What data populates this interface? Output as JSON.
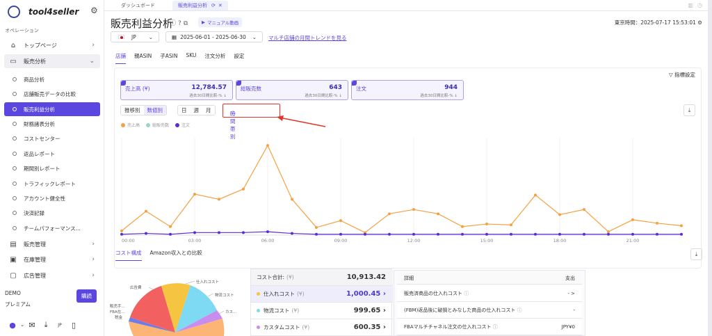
{
  "sidebar": {
    "logo": "tool4seller",
    "section_label": "オペレーション",
    "nav": [
      {
        "label": "トップページ",
        "icon": "home-icon"
      },
      {
        "label": "販売分析",
        "icon": "chart-icon"
      }
    ],
    "sub_items": [
      "商品分析",
      "店舗販売データの比較",
      "販売利益分析",
      "財務諸表分析",
      "コストセンター",
      "返品レポート",
      "期間別レポート",
      "トラフィックレポート",
      "アカウント健全性",
      "決済記録",
      "チームパフォーマンス..."
    ],
    "active_sub": "販売利益分析",
    "nav_bottom": [
      {
        "label": "販売管理",
        "icon": "box-icon"
      },
      {
        "label": "在庫管理",
        "icon": "warehouse-icon"
      },
      {
        "label": "広告管理",
        "icon": "monitor-icon"
      }
    ],
    "plan_name": "DEMO",
    "plan_tier": "プレミアム",
    "buy_label": "購読"
  },
  "tabs": [
    {
      "label": "ダッシュボード"
    },
    {
      "label": "販売利益分析"
    }
  ],
  "header": {
    "title": "販売利益分析",
    "manual_label": "マニュアル動画",
    "clock": "東京時間：2025-07-17 15:53:01",
    "country": "JP",
    "date_range": "2025-06-01 - 2025-06-30",
    "trend_link": "マルチ店舗の月間トレンドを見る"
  },
  "main": {
    "subtabs": [
      "店舗",
      "親ASIN",
      "子ASIN",
      "SKU",
      "注文分析",
      "設定"
    ],
    "filter_label": "指標設定",
    "metrics": [
      {
        "label": "売上高 (¥)",
        "value": "12,784.57",
        "sub": "過去30日間比較-% ↓"
      },
      {
        "label": "総販売数",
        "value": "643",
        "sub": "過去30日間比較-% ↓"
      },
      {
        "label": "注文",
        "value": "944",
        "sub": "過去30日間比較-% ↓"
      }
    ],
    "view_mode": [
      "推移別",
      "数値別"
    ],
    "granularity": [
      "日",
      "週",
      "月"
    ],
    "hourly_label": "時間帯別",
    "legend": [
      {
        "name": "売上高",
        "color": "#f5a142"
      },
      {
        "name": "総販売数",
        "color": "#9ad8c0"
      },
      {
        "name": "注文",
        "color": "#5b2bd6"
      }
    ],
    "bottom_tabs": [
      "コスト構成",
      "Amazon収入との比較"
    ],
    "cost_total_label": "コスト合計:",
    "cost_total_unit": "(¥)",
    "cost_total": "10,913.42",
    "cost_rows": [
      {
        "label": "仕入れコスト",
        "unit": "(¥)",
        "value": "1,000.45",
        "color": "#f5c542"
      },
      {
        "label": "物流コスト",
        "unit": "(¥)",
        "value": "999.65",
        "color": "#7ed9f2"
      },
      {
        "label": "カスタムコスト",
        "unit": "(¥)",
        "value": "600.35",
        "color": "#c98df0"
      }
    ],
    "detail_header": {
      "left": "詳細",
      "right": "支出"
    },
    "detail_rows": [
      {
        "label": "販売済商品の仕入れコスト",
        "value": "- >"
      },
      {
        "label": "(FBM)返品後に破損とみなした商品の仕入れコスト",
        "value": "-"
      },
      {
        "label": "FBAマルチチャネル注文の仕入れコスト",
        "value": "JPY¥0"
      }
    ],
    "pie_labels": [
      "仕入れコスト",
      "物流コスト",
      "カス...",
      "広告費",
      "販売手...",
      "FBA在...",
      "税金"
    ]
  },
  "chart_data": {
    "type": "line",
    "x": [
      "00:00",
      "01:00",
      "02:00",
      "03:00",
      "04:00",
      "05:00",
      "06:00",
      "07:00",
      "08:00",
      "09:00",
      "10:00",
      "11:00",
      "12:00",
      "13:00",
      "14:00",
      "15:00",
      "16:00",
      "17:00",
      "18:00",
      "19:00",
      "20:00",
      "21:00",
      "22:00",
      "23:00"
    ],
    "xticks": [
      "00:00",
      "03:00",
      "06:00",
      "09:00",
      "12:00",
      "15:00",
      "18:00",
      "21:00"
    ],
    "series": [
      {
        "name": "売上高",
        "color": "#f5a142",
        "values": [
          50,
          280,
          100,
          480,
          420,
          540,
          1050,
          420,
          90,
          170,
          30,
          250,
          300,
          250,
          100,
          130,
          120,
          470,
          240,
          300,
          40,
          180,
          140,
          110
        ]
      },
      {
        "name": "注文",
        "color": "#5b2bd6",
        "values": [
          10,
          20,
          10,
          30,
          30,
          30,
          40,
          20,
          10,
          10,
          10,
          10,
          10,
          10,
          10,
          10,
          10,
          10,
          10,
          10,
          10,
          10,
          10,
          10
        ]
      }
    ],
    "ylim": [
      0,
      1100
    ]
  }
}
